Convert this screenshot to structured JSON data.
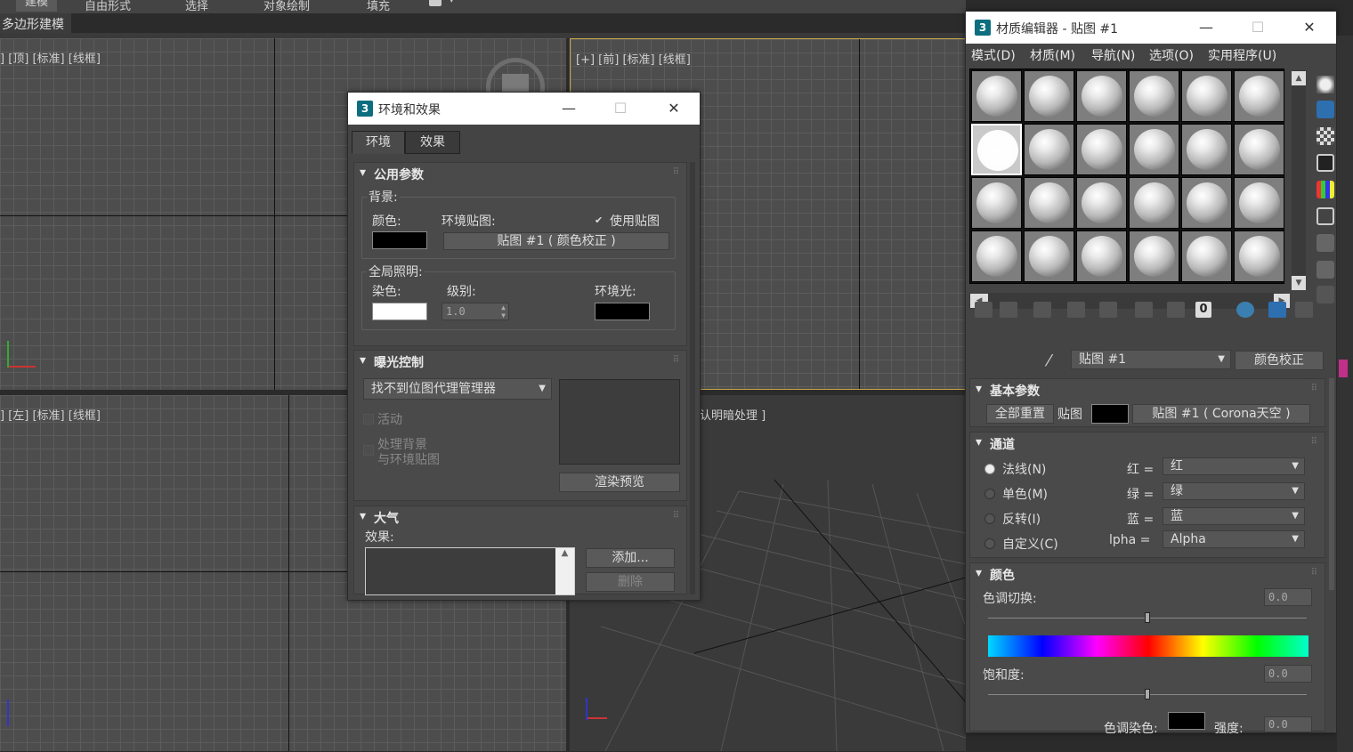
{
  "ribbon": {
    "tabs": [
      "建模",
      "自由形式",
      "选择",
      "对象绘制",
      "填充"
    ],
    "sub_label": "多边形建模"
  },
  "viewports": {
    "top": "] [顶] [标准] [线框]",
    "front": "[+] [前] [标准] [线框]",
    "left": "] [左] [标准] [线框]",
    "persp": "认明暗处理 ]"
  },
  "env_dialog": {
    "title": "环境和效果",
    "app_icon": "3",
    "tabs": [
      "环境",
      "效果"
    ],
    "common_params": {
      "header": "公用参数",
      "background_label": "背景:",
      "color_label": "颜色:",
      "env_map_label": "环境贴图:",
      "use_map_label": "使用贴图",
      "env_map_button": "贴图 #1  ( 颜色校正 )",
      "bg_color": "#000000",
      "global_light_label": "全局照明:",
      "tint_label": "染色:",
      "level_label": "级别:",
      "level_value": "1.0",
      "ambient_label": "环境光:",
      "tint_color": "#ffffff",
      "ambient_color": "#000000"
    },
    "exposure": {
      "header": "曝光控制",
      "dropdown": "找不到位图代理管理器",
      "active_label": "活动",
      "process_bg_label1": "处理背景",
      "process_bg_label2": "与环境贴图",
      "render_preview": "渲染预览"
    },
    "atmosphere": {
      "header": "大气",
      "effects_label": "效果:",
      "add_button": "添加...",
      "delete_button": "删除"
    }
  },
  "mat_editor": {
    "title": "材质编辑器 - 贴图 #1",
    "app_icon": "3",
    "menu": [
      "模式(D)",
      "材质(M)",
      "导航(N)",
      "选项(O)",
      "实用程序(U)"
    ],
    "map_name": "贴图 #1",
    "map_type_button": "颜色校正",
    "toolbar_value": "0",
    "basic_params": {
      "header": "基本参数",
      "reset_all": "全部重置",
      "map_label": "贴图",
      "map_button": "贴图 #1  ( Corona天空 )",
      "swatch_color": "#000000"
    },
    "channels": {
      "header": "通道",
      "options": [
        "法线(N)",
        "单色(M)",
        "反转(I)",
        "自定义(C)"
      ],
      "rows": [
        {
          "label": "红 =",
          "value": "红"
        },
        {
          "label": "绿 =",
          "value": "绿"
        },
        {
          "label": "蓝 =",
          "value": "蓝"
        },
        {
          "label": "lpha =",
          "value": "Alpha"
        }
      ]
    },
    "color": {
      "header": "颜色",
      "hue_label": "色调切换:",
      "hue_value": "0.0",
      "sat_label": "饱和度:",
      "sat_value": "0.0",
      "tint_label": "色调染色:",
      "strength_label": "强度:",
      "strength_value": "0.0"
    }
  },
  "icons": [
    "close-icon",
    "minimize-icon",
    "maximize-icon",
    "eyedropper-icon",
    "checkbox-checked-icon",
    "dropdown-arrow-icon",
    "scroll-up-icon",
    "scroll-left-icon",
    "scroll-right-icon",
    "sphere-sample-icon",
    "delete-icon",
    "save-icon",
    "background-icon"
  ]
}
